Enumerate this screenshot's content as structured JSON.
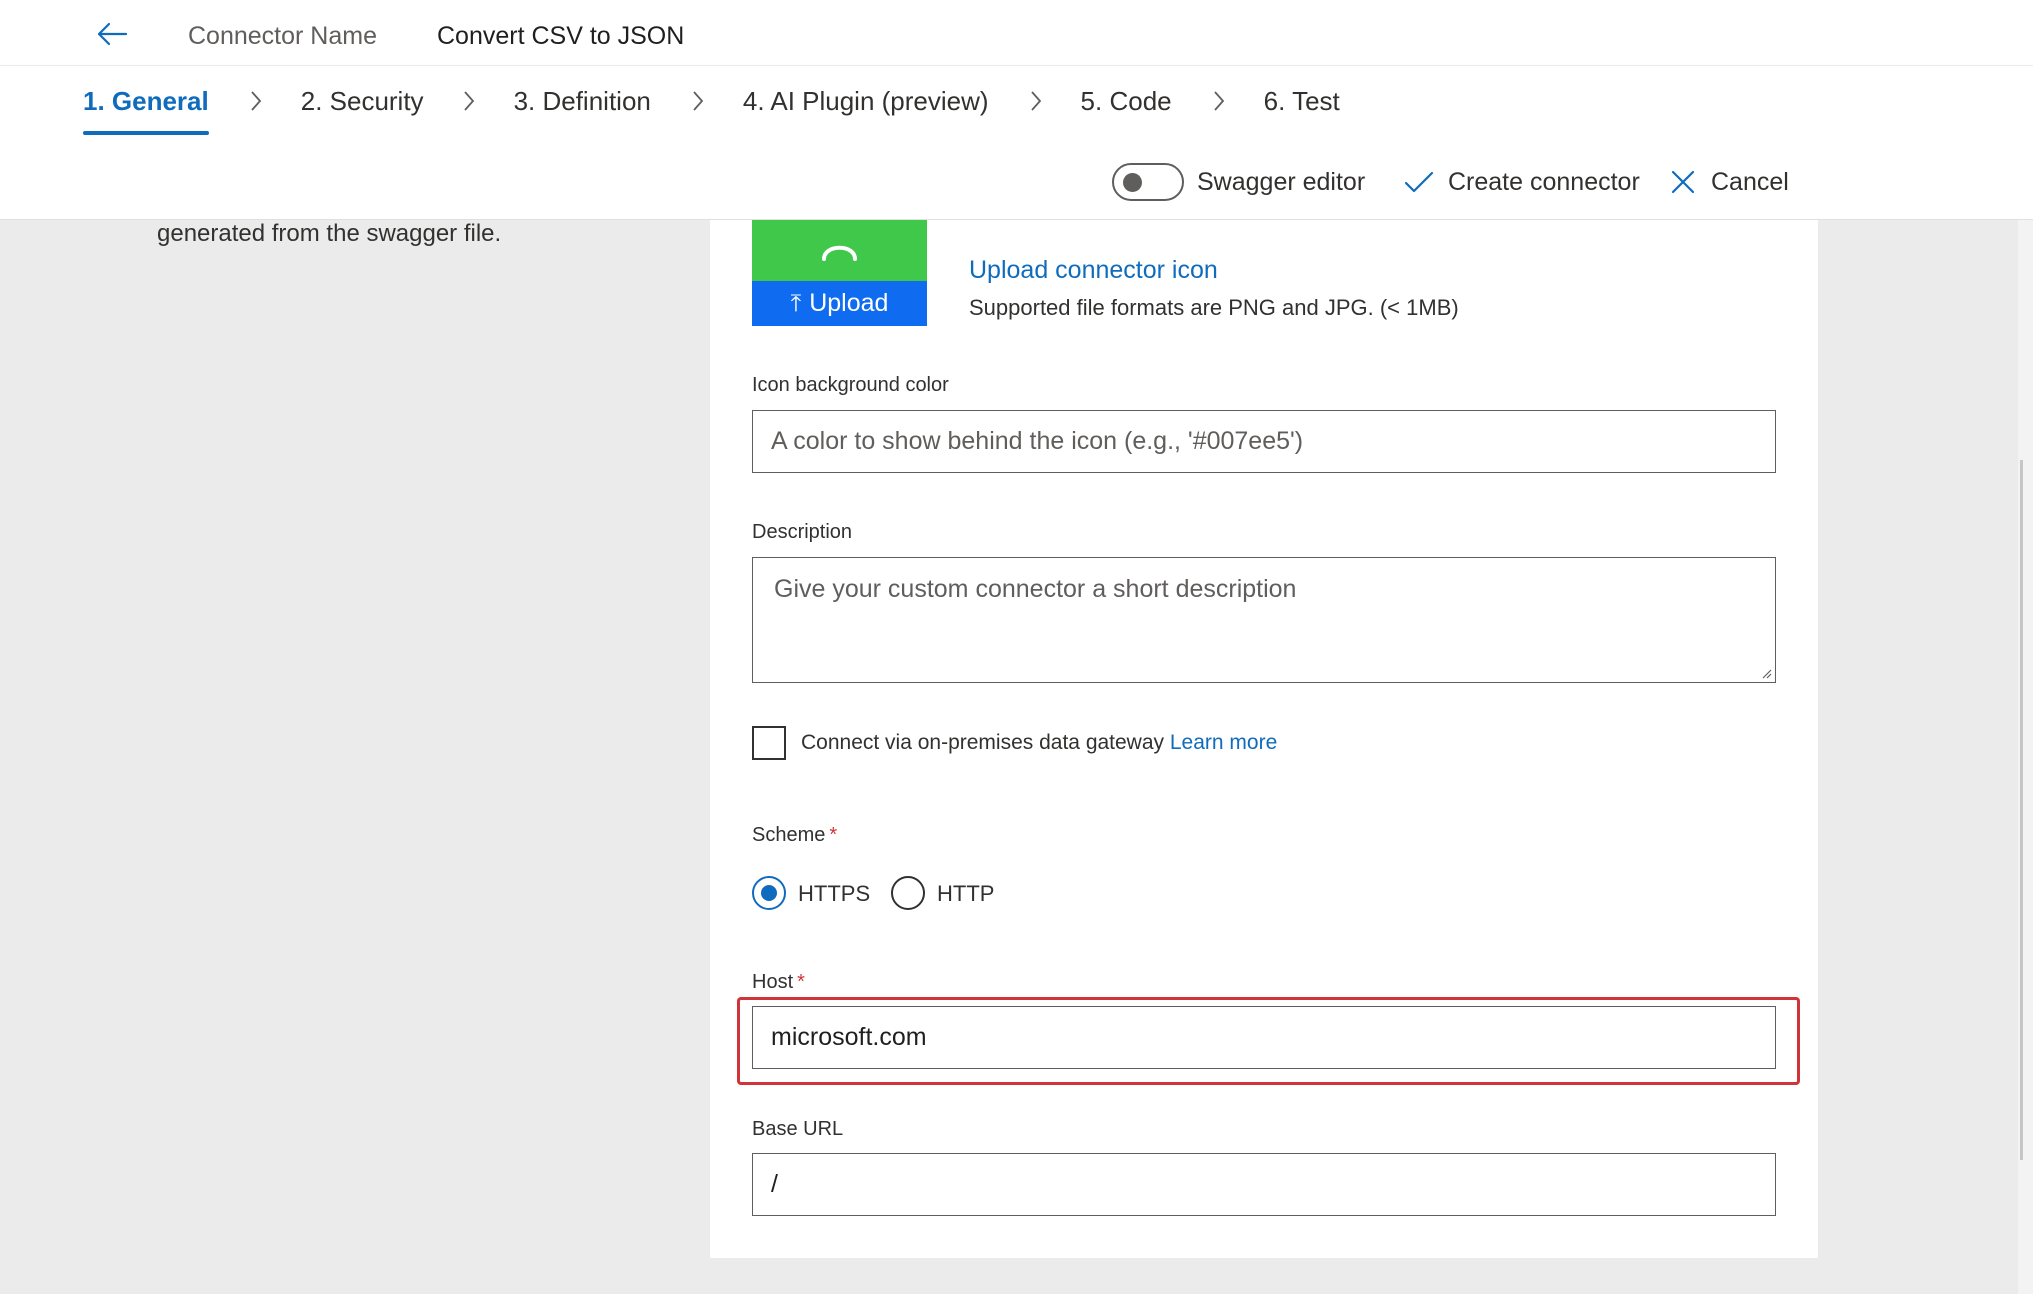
{
  "header": {
    "connector_name_label": "Connector Name",
    "connector_name_value": "Convert CSV to JSON"
  },
  "steps": [
    {
      "label": "1. General",
      "active": true
    },
    {
      "label": "2. Security",
      "active": false
    },
    {
      "label": "3. Definition",
      "active": false
    },
    {
      "label": "4. AI Plugin (preview)",
      "active": false
    },
    {
      "label": "5. Code",
      "active": false
    },
    {
      "label": "6. Test",
      "active": false
    }
  ],
  "actions": {
    "swagger_editor_label": "Swagger editor",
    "swagger_editor_on": false,
    "create_label": "Create connector",
    "cancel_label": "Cancel"
  },
  "left_description": "generated from the swagger file.",
  "icon_upload": {
    "upload_button": "Upload",
    "upload_link": "Upload connector icon",
    "hint": "Supported file formats are PNG and JPG. (< 1MB)",
    "icon_color": "#3fc84a"
  },
  "form": {
    "icon_bg_label": "Icon background color",
    "icon_bg_placeholder": "A color to show behind the icon (e.g., '#007ee5')",
    "description_label": "Description",
    "description_placeholder": "Give your custom connector a short description",
    "gateway_label": "Connect via on-premises data gateway",
    "gateway_learn_more": "Learn more",
    "gateway_checked": false,
    "scheme_label": "Scheme",
    "scheme_options": [
      "HTTPS",
      "HTTP"
    ],
    "scheme_selected": "HTTPS",
    "host_label": "Host",
    "host_value": "microsoft.com",
    "base_url_label": "Base URL",
    "base_url_value": "/",
    "required_marker": "*"
  },
  "colors": {
    "accent": "#0f6cbd",
    "required": "#d13438",
    "highlight": "#d13438"
  }
}
